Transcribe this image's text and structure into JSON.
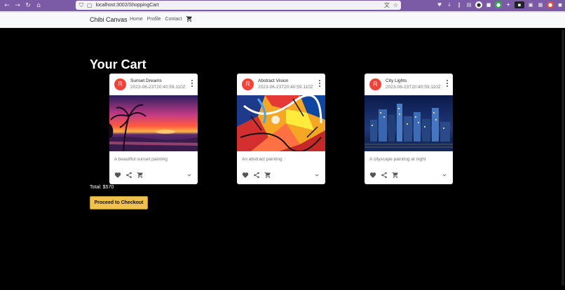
{
  "browser": {
    "url": "localhost:3002/ShoppingCart",
    "nav_icons": [
      "back-icon",
      "forward-icon",
      "reload-icon",
      "home-icon"
    ],
    "accent": "#7b5aa6"
  },
  "navbar": {
    "brand": "Chibi Canvas",
    "links": [
      {
        "label": "Home"
      },
      {
        "label": "Profile"
      },
      {
        "label": "Contact"
      }
    ],
    "cart_icon": "shopping-cart-icon"
  },
  "page": {
    "title": "Your Cart",
    "total": "Total: $570",
    "checkout_label": "Proceed to Checkout",
    "checkout_color": "#f0c14b"
  },
  "cards": [
    {
      "avatar": "R",
      "title": "Sunset Dreams",
      "date": "2023-06-23T20:40:59.110Z",
      "description": "A beautiful sunset painting",
      "image": "sunset-painting"
    },
    {
      "avatar": "R",
      "title": "Abstract Vision",
      "date": "2023-06-23T20:40:59.110Z",
      "description": "An abstract painting",
      "image": "abstract-painting"
    },
    {
      "avatar": "R",
      "title": "City Lights",
      "date": "2023-06-23T20:40:59.110Z",
      "description": "A cityscape painting at night",
      "image": "cityscape-painting"
    }
  ],
  "colors": {
    "avatar": "#f44336",
    "background": "#000000"
  }
}
